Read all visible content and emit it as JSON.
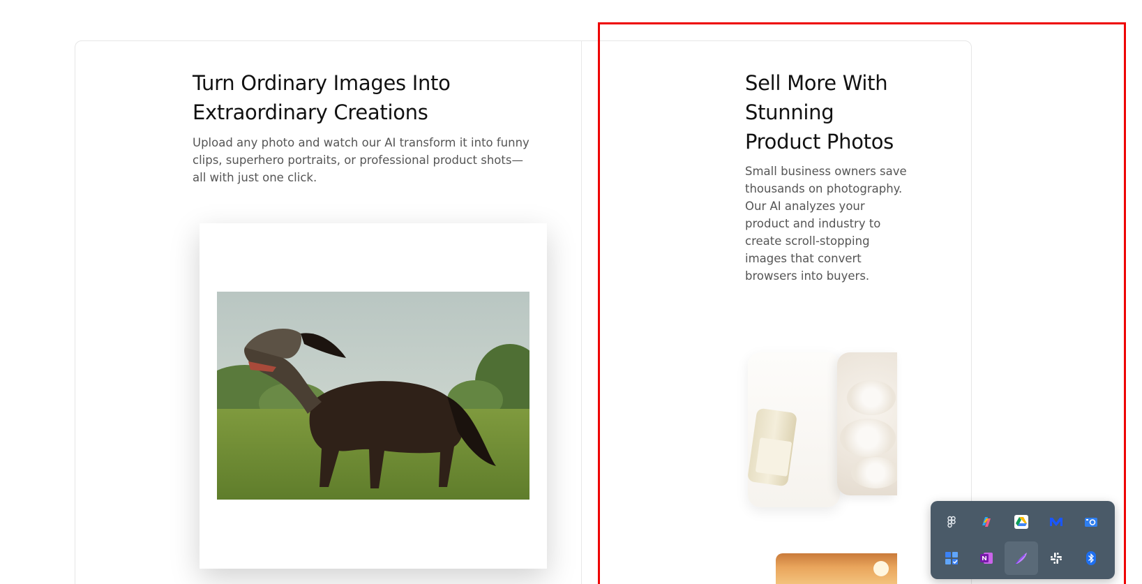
{
  "left_panel": {
    "title": "Turn Ordinary Images Into Extraordinary Creations",
    "description": "Upload any photo and watch our AI transform it into funny clips, superhero portraits, or professional product shots—all with just one click."
  },
  "right_panel": {
    "title": "Sell More With Stunning Product Photos",
    "description": "Small business owners save thousands on photography. Our AI analyzes your product and industry to create scroll-stopping images that convert browsers into buyers."
  },
  "colors": {
    "highlight_border": "#ee0000",
    "tray_background": "#4a5a68",
    "title_text": "#111111",
    "body_text": "#555555"
  },
  "tray": {
    "items": [
      {
        "icon": "figma-icon"
      },
      {
        "icon": "copilot-icon"
      },
      {
        "icon": "google-drive-icon"
      },
      {
        "icon": "meet-icon"
      },
      {
        "icon": "camera-icon"
      },
      {
        "icon": "tasks-icon"
      },
      {
        "icon": "onenote-icon"
      },
      {
        "icon": "feather-icon",
        "active": true
      },
      {
        "icon": "slack-icon"
      },
      {
        "icon": "bluetooth-icon"
      }
    ]
  }
}
